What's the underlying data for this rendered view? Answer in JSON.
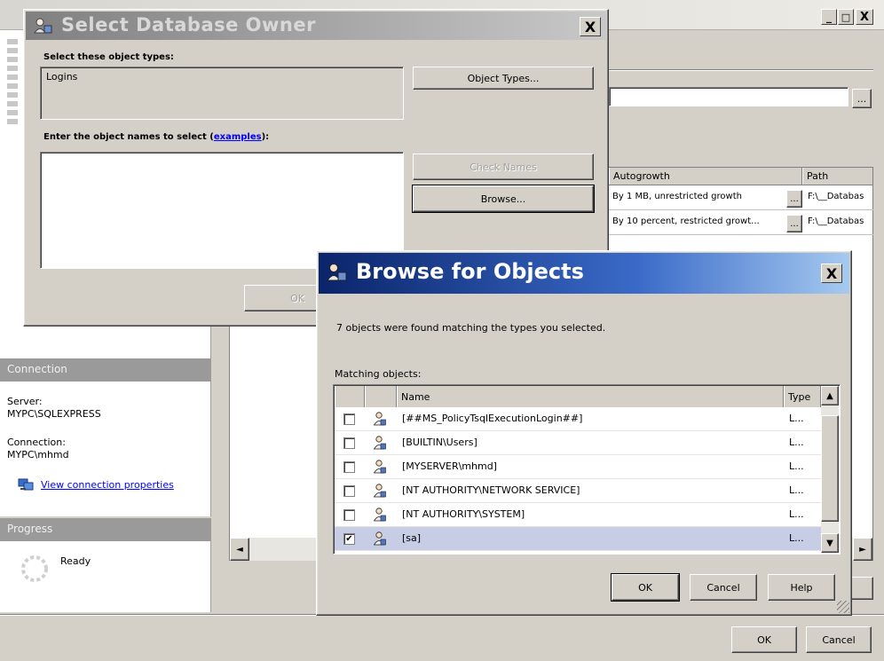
{
  "bg_window": {
    "min_glyph": "_",
    "max_glyph": "□",
    "close_glyph": "X",
    "file_grid": {
      "headers": [
        "Autogrowth",
        "Path"
      ],
      "rows": [
        {
          "autogrowth": "By 1 MB, unrestricted growth",
          "path": "F:\\__Databas"
        },
        {
          "autogrowth": "By 10 percent, restricted growt...",
          "path": "F:\\__Databas"
        }
      ],
      "ellipsis": "..."
    },
    "owner_browse_glyph": "...",
    "connection": {
      "header": "Connection",
      "server_label": "Server:",
      "server_value": "MYPC\\SQLEXPRESS",
      "connection_label": "Connection:",
      "connection_value": "MYPC\\mhmd",
      "view_link": "View connection properties"
    },
    "progress": {
      "header": "Progress",
      "status": "Ready"
    },
    "ok_label": "OK",
    "cancel_label": "Cancel",
    "scroll_left_glyph": "◄",
    "scroll_right_glyph": "►"
  },
  "select_owner": {
    "title": "Select Database Owner",
    "close_glyph": "X",
    "object_types_label": "Select these object types:",
    "object_types_value": "Logins",
    "object_types_button": "Object Types...",
    "enter_names_label": "Enter the object names to select (",
    "examples_link": "examples",
    "enter_names_suffix": "):",
    "names_value": "",
    "check_names_button": "Check Names",
    "browse_button": "Browse...",
    "ok_label": "OK"
  },
  "browse": {
    "title": "Browse for Objects",
    "close_glyph": "X",
    "found_text": "7 objects were found matching the types you selected.",
    "matching_label": "Matching objects:",
    "columns": [
      "",
      "",
      "Name",
      "Type"
    ],
    "rows": [
      {
        "name": "[##MS_PolicyTsqlExecutionLogin##]",
        "type": "L...",
        "checked": false
      },
      {
        "name": "[BUILTIN\\Users]",
        "type": "L...",
        "checked": false
      },
      {
        "name": "[MYSERVER\\mhmd]",
        "type": "L...",
        "checked": false
      },
      {
        "name": "[NT AUTHORITY\\NETWORK SERVICE]",
        "type": "L...",
        "checked": false
      },
      {
        "name": "[NT AUTHORITY\\SYSTEM]",
        "type": "L...",
        "checked": false
      },
      {
        "name": "[sa]",
        "type": "L...",
        "checked": true
      }
    ],
    "scroll_up_glyph": "▲",
    "scroll_down_glyph": "▼",
    "check_glyph": "✔",
    "ok_label": "OK",
    "cancel_label": "Cancel",
    "help_label": "Help"
  },
  "colors": {
    "title_active": "#0a246a",
    "title_active_end": "#a6caf0",
    "title_inactive": "#808080",
    "selected_row": "#c6cde5",
    "panel_header": "#9a9a9a"
  }
}
